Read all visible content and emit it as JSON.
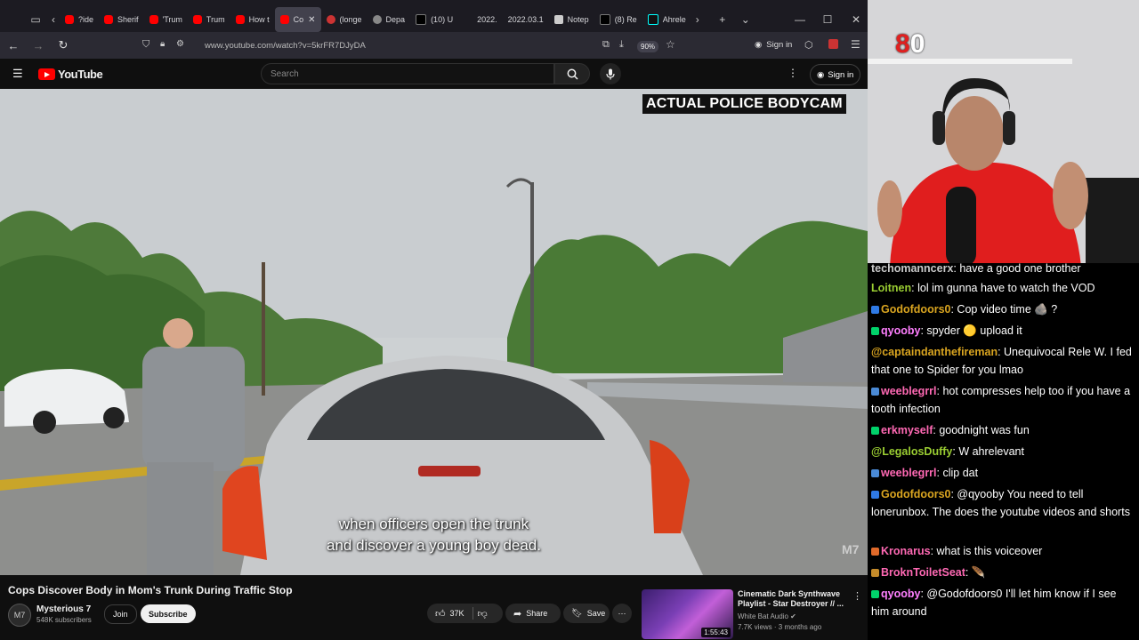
{
  "browser": {
    "tabs": [
      {
        "label": "?ide",
        "icon": "youtube"
      },
      {
        "label": "Sherif",
        "icon": "youtube"
      },
      {
        "label": "'Trum",
        "icon": "youtube"
      },
      {
        "label": "Trum",
        "icon": "youtube"
      },
      {
        "label": "How t",
        "icon": "youtube"
      },
      {
        "label": "Co",
        "icon": "youtube",
        "active": true
      },
      {
        "label": "(longe",
        "icon": "reddit"
      },
      {
        "label": "Depa",
        "icon": "globe"
      },
      {
        "label": "(10) U",
        "icon": "x"
      },
      {
        "label": "2022.",
        "icon": "doc"
      },
      {
        "label": "2022.03.1",
        "icon": "doc"
      },
      {
        "label": "Notep",
        "icon": "note"
      },
      {
        "label": "(8) Re",
        "icon": "x"
      },
      {
        "label": "Ahrele",
        "icon": "tiktok"
      }
    ],
    "url": "www.youtube.com/watch?v=5krFR7DJyDA",
    "zoom": "90%",
    "signin": "Sign in"
  },
  "youtube": {
    "logo": "YouTube",
    "search_placeholder": "Search",
    "signin": "Sign in",
    "video": {
      "banner": "ACTUAL POLICE BODYCAM",
      "subtitle_line1": "when officers open the trunk",
      "subtitle_line2": "and discover a young boy dead.",
      "watermark": "M7"
    },
    "title": "Cops Discover Body in Mom's Trunk During Traffic Stop",
    "channel": {
      "avatar": "M7",
      "name": "Mysterious 7",
      "subscribers": "548K subscribers",
      "join": "Join",
      "subscribe": "Subscribe"
    },
    "actions": {
      "likes": "37K",
      "share": "Share",
      "save": "Save"
    },
    "recommended": {
      "title": "Cinematic Dark Synthwave Playlist - Star Destroyer // ...",
      "channel": "White Bat Audio",
      "meta": "7.7K views · 3 months ago",
      "duration": "1:55:43"
    }
  },
  "stream": {
    "counter_prefix": "8",
    "counter_suffix": "0"
  },
  "chat": [
    {
      "user": "techomanncerx",
      "text": ": have a good one brother",
      "color": "#c9c9c9",
      "badge": ""
    },
    {
      "user": "Loitnen",
      "text": ": lol im gunna have to watch the VOD",
      "color": "#9acd32",
      "badge": ""
    },
    {
      "user": "Godofdoors0",
      "text": ": Cop video time 🪨 ?",
      "color": "#daa520",
      "badge": "#2f7ae5"
    },
    {
      "user": "qyooby",
      "text": ": spyder 🟡 upload it",
      "color": "#ff7fff",
      "badge": "#00d26a"
    },
    {
      "user": "@captaindanthefireman",
      "text": ": Unequivocal Rele W. I fed that one to Spider for you lmao",
      "color": "#daa520",
      "badge": ""
    },
    {
      "user": "weeblegrrl",
      "text": ": hot compresses help too if you have a tooth infection",
      "color": "#ff69b4",
      "badge": "#4a8ad6"
    },
    {
      "user": "erkmyself",
      "text": ": goodnight was fun",
      "color": "#ff69b4",
      "badge": "#00d26a"
    },
    {
      "user": "@LegalosDuffy",
      "text": ": W ahrelevant",
      "color": "#9acd32",
      "badge": ""
    },
    {
      "user": "weeblegrrl",
      "text": ": clip dat",
      "color": "#ff69b4",
      "badge": "#4a8ad6"
    },
    {
      "user": "Godofdoors0",
      "text": ": @qyooby You need to tell lonerunbox. The does the youtube videos and shorts",
      "color": "#daa520",
      "badge": "#2f7ae5"
    },
    {
      "user": "Kronarus",
      "text": ": what is this voiceover",
      "color": "#ff69b4",
      "badge": "#e06a2a"
    },
    {
      "user": "BroknToiletSeat",
      "text": ": 🪶",
      "color": "#ff69b4",
      "badge": "#c58b2a"
    },
    {
      "user": "qyooby",
      "text": ": @Godofdoors0 I'll let him know if I see him around",
      "color": "#ff7fff",
      "badge": "#00d26a"
    }
  ]
}
